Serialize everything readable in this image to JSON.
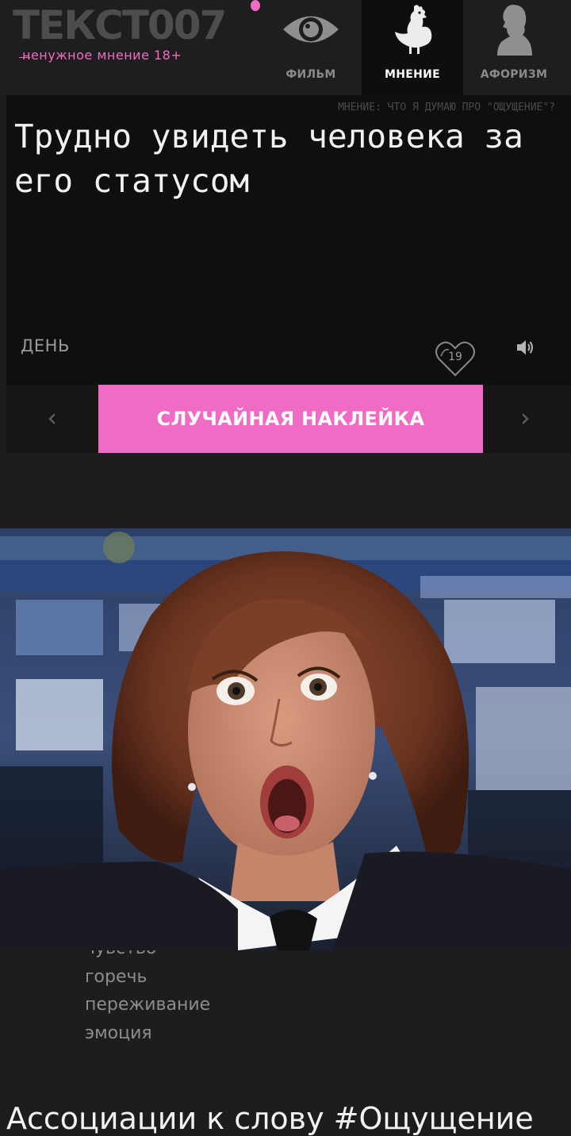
{
  "header": {
    "logo_title": "ТЕКСТ007",
    "logo_subtitle": "ненужное мнение 18+",
    "tabs": [
      {
        "label": "ФИЛЬМ",
        "icon": "eye-icon"
      },
      {
        "label": "МНЕНИЕ",
        "icon": "chicken-icon",
        "active": true
      },
      {
        "label": "АФОРИЗМ",
        "icon": "bust-profile-icon"
      }
    ]
  },
  "card": {
    "caption": "МНЕНИЕ: ЧТО Я ДУМАЮ ПРО \"ОЩУЩЕНИЕ\"?",
    "text": "Трудно увидеть человека за его статусом",
    "day_label": "ДЕНЬ",
    "likes": "19",
    "sound_icon": "speaker-icon",
    "like_icon": "heart-icon"
  },
  "sticker_bar": {
    "random_label": "СЛУЧАЙНАЯ НАКЛЕЙКА",
    "prev_icon": "chevron-left-icon",
    "next_icon": "chevron-right-icon"
  },
  "synonyms": [
    "чувство",
    "горечь",
    "переживание",
    "эмоция"
  ],
  "associations_heading": "Ассоциации к слову #Ощущение",
  "colors": {
    "accent": "#f06bc3",
    "background": "#1d1d1d",
    "card": "#0e1010"
  }
}
